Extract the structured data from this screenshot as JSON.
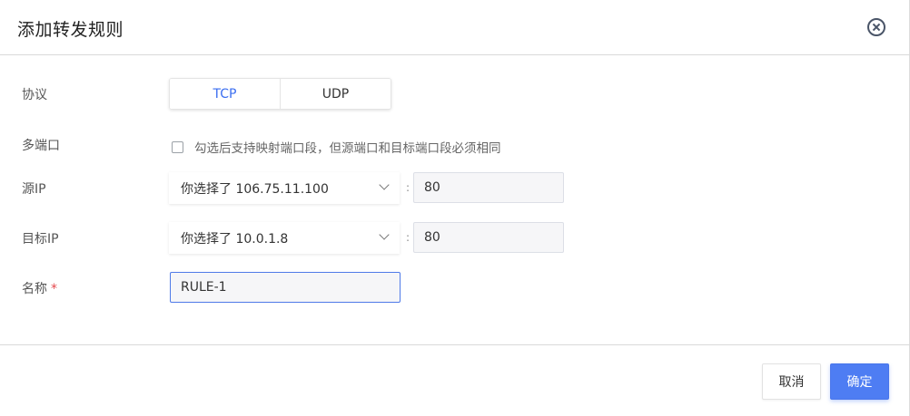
{
  "dialog": {
    "title": "添加转发规则",
    "close_icon": "close-circle-icon"
  },
  "form": {
    "protocol": {
      "label": "协议",
      "options": [
        "TCP",
        "UDP"
      ],
      "selected": "TCP"
    },
    "multi_port": {
      "label": "多端口",
      "checked": false,
      "hint": "勾选后支持映射端口段，但源端口和目标端口段必须相同"
    },
    "source_ip": {
      "label": "源IP",
      "selected": "你选择了 106.75.11.100",
      "separator": ":",
      "port": "80"
    },
    "target_ip": {
      "label": "目标IP",
      "selected": "你选择了 10.0.1.8",
      "separator": ":",
      "port": "80"
    },
    "name": {
      "label": "名称",
      "required_mark": "*",
      "value": "RULE-1"
    }
  },
  "footer": {
    "cancel_label": "取消",
    "ok_label": "确定"
  },
  "colors": {
    "accent": "#4e7df3",
    "active_text": "#3b6ef0",
    "required": "#e5484d"
  }
}
